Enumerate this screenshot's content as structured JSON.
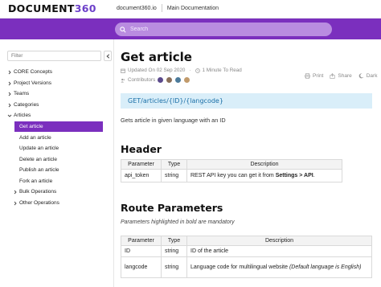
{
  "header": {
    "logo_text": "DOCUMENT",
    "logo_num": "360",
    "nav": [
      "document360.io",
      "Main Documentation"
    ]
  },
  "search": {
    "placeholder": "Search"
  },
  "sidebar": {
    "filter_placeholder": "Filter",
    "items": [
      {
        "label": "CORE Concepts",
        "expanded": false
      },
      {
        "label": "Project Versions",
        "expanded": false
      },
      {
        "label": "Teams",
        "expanded": false
      },
      {
        "label": "Categories",
        "expanded": false
      },
      {
        "label": "Articles",
        "expanded": true
      },
      {
        "label": "Get article",
        "active": true
      },
      {
        "label": "Add an article"
      },
      {
        "label": "Update an article"
      },
      {
        "label": "Delete an article"
      },
      {
        "label": "Publish an article"
      },
      {
        "label": "Fork an article"
      },
      {
        "label": "Bulk Operations",
        "expanded": false
      },
      {
        "label": "Other Operations",
        "expanded": false
      }
    ]
  },
  "article": {
    "title": "Get article",
    "updated": "Updated On 02 Sep 2020",
    "read_time": "1 Minute To Read",
    "contributors_label": "Contributors",
    "tools": {
      "print": "Print",
      "share": "Share",
      "dark": "Dark"
    },
    "endpoint": "GET/articles/{ID}/{langcode}",
    "description": "Gets article in given language with an ID",
    "header_section": {
      "title": "Header",
      "columns": [
        "Parameter",
        "Type",
        "Description"
      ],
      "rows": [
        {
          "parameter": "api_token",
          "type": "string",
          "desc_prefix": "REST API key you can get it from ",
          "desc_bold": "Settings > API",
          "desc_suffix": "."
        }
      ]
    },
    "route_section": {
      "title": "Route Parameters",
      "note": "Parameters highlighted in bold are mandatory",
      "columns": [
        "Parameter",
        "Type",
        "Description"
      ],
      "rows": [
        {
          "parameter": "ID",
          "type": "string",
          "description": "ID of the article",
          "note": ""
        },
        {
          "parameter": "langcode",
          "type": "string",
          "description": "Language code for multilingual website ",
          "note": "(Default language is English)"
        }
      ]
    }
  },
  "colors": {
    "brand": "#7b2fbe",
    "search_bg": "#b98ce0",
    "endpoint_bg": "#d9eef9",
    "endpoint_text": "#1a6fa7"
  }
}
